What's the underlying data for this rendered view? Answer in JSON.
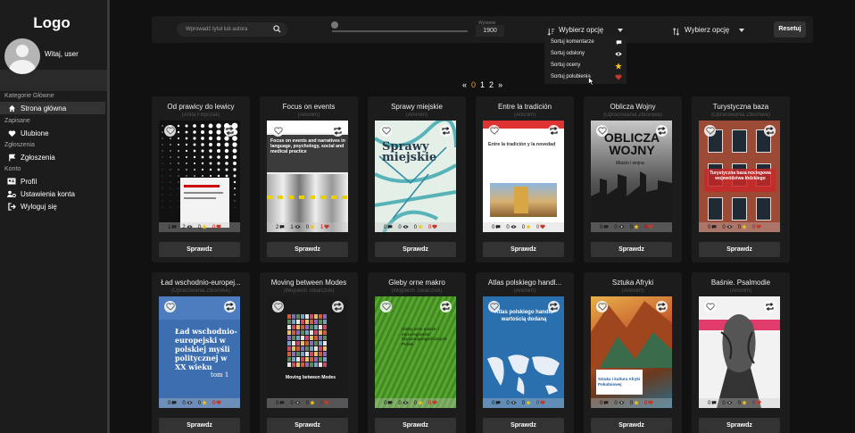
{
  "sidebar": {
    "logo": "Logo",
    "greeting": "Witaj, user",
    "sections": [
      {
        "label": "Kategorie Główne",
        "items": [
          {
            "label": "Strona główna",
            "icon": "home-icon",
            "active": true
          }
        ]
      },
      {
        "label": "Zapisane",
        "items": [
          {
            "label": "Ulubione",
            "icon": "heart-icon"
          }
        ]
      },
      {
        "label": "Zgłoszenia",
        "items": [
          {
            "label": "Zgłoszenia",
            "icon": "flag-icon"
          }
        ]
      },
      {
        "label": "Konto",
        "items": [
          {
            "label": "Profil",
            "icon": "id-card-icon"
          },
          {
            "label": "Ustawienia konta",
            "icon": "users-gear-icon"
          },
          {
            "label": "Wyloguj się",
            "icon": "logout-icon"
          }
        ]
      }
    ]
  },
  "toolbar": {
    "search_placeholder": "Wprowadź tytuł lub autora",
    "year_label": "Wydanie",
    "year_value": "1900",
    "sort_select_label": "Wybierz opcję",
    "filter_select_label": "Wybierz opcję",
    "reset_label": "Resetuj"
  },
  "sort_dropdown": [
    {
      "label": "Sortuj komentarze",
      "icon": "comment-icon"
    },
    {
      "label": "Sortuj odsłony",
      "icon": "eye-icon"
    },
    {
      "label": "Sortuj oceny",
      "icon": "star-icon"
    },
    {
      "label": "Sortuj polubienia",
      "icon": "heart-icon"
    }
  ],
  "pagination": {
    "prev": "«",
    "pages": [
      "0",
      "1",
      "2"
    ],
    "current": "0",
    "next": "»"
  },
  "card_button_label": "Sprawdz",
  "books": [
    {
      "title": "Od prawicy do lewicy",
      "author": "(Anita Filipczak)",
      "comments": "1",
      "views": "2",
      "rating": "0",
      "likes": "0"
    },
    {
      "title": "Focus on events",
      "author": "(Anonim)",
      "comments": "2",
      "views": "1",
      "rating": "0",
      "likes": "1"
    },
    {
      "title": "Sprawy miejskie",
      "author": "(Anonim)",
      "comments": "0",
      "views": "0",
      "rating": "0",
      "likes": "0"
    },
    {
      "title": "Entre la tradición",
      "author": "(Anonim)",
      "comments": "0",
      "views": "0",
      "rating": "0",
      "likes": "0"
    },
    {
      "title": "Oblicza Wojny",
      "author": "(Opracowania Zbiorowe)",
      "comments": "0",
      "views": "0",
      "rating": "0",
      "likes": "0"
    },
    {
      "title": "Turystyczna baza",
      "author": "(Opracowania Zbiorowe)",
      "comments": "0",
      "views": "0",
      "rating": "0",
      "likes": "0"
    },
    {
      "title": "Ład wschodnio-europej...",
      "author": "(Opracowania Zbiorowe)",
      "comments": "0",
      "views": "0",
      "rating": "0",
      "likes": "0"
    },
    {
      "title": "Moving between Modes",
      "author": "(Wojciech Tokarczuk)",
      "comments": "0",
      "views": "0",
      "rating": "0",
      "likes": "0"
    },
    {
      "title": "Gleby orne makro",
      "author": "(Wojciech Tokarczuk)",
      "comments": "0",
      "views": "0",
      "rating": "0",
      "likes": "0"
    },
    {
      "title": "Atlas polskiego handl...",
      "author": "(Anonim)",
      "comments": "0",
      "views": "0",
      "rating": "0",
      "likes": "0"
    },
    {
      "title": "Sztuka Afryki",
      "author": "(Anonim)",
      "comments": "0",
      "views": "0",
      "rating": "0",
      "likes": "0"
    },
    {
      "title": "Baśnie. Psalmodie",
      "author": "(Anonim)",
      "comments": "0",
      "views": "0",
      "rating": "0",
      "likes": "0"
    }
  ],
  "covers": {
    "focus": {
      "title": "Focus on events and narratives in language, psychology, social and medical practice"
    },
    "sprawy": {
      "title": "Sprawy miejskie"
    },
    "entre": {
      "title": "Entre la tradición y la novedad"
    },
    "oblicza": {
      "title": "OBLICZA WOJNY",
      "subtitle": "Miasto i wojna"
    },
    "turyst": {
      "title": "Turystyczna baza noclegowa województwa łódzkiego"
    },
    "lad": {
      "title": "Ład wschodnio-europejski w polskiej myśli politycznej w XX wieku",
      "vol": "tom 1"
    },
    "moving": {
      "title": "Moving between Modes"
    },
    "gleby": {
      "title": "Gleby orne makro- i mezoregionów fizycznogeograficznych Polski"
    },
    "atlas": {
      "title": "Atlas polskiego handlu wartością dodaną"
    },
    "sztuka": {
      "title": "Sztuka i kultura Afryki Południowej"
    }
  },
  "colors": {
    "accent": "#e8a030",
    "like": "#c0392b",
    "star": "#f0c419"
  }
}
